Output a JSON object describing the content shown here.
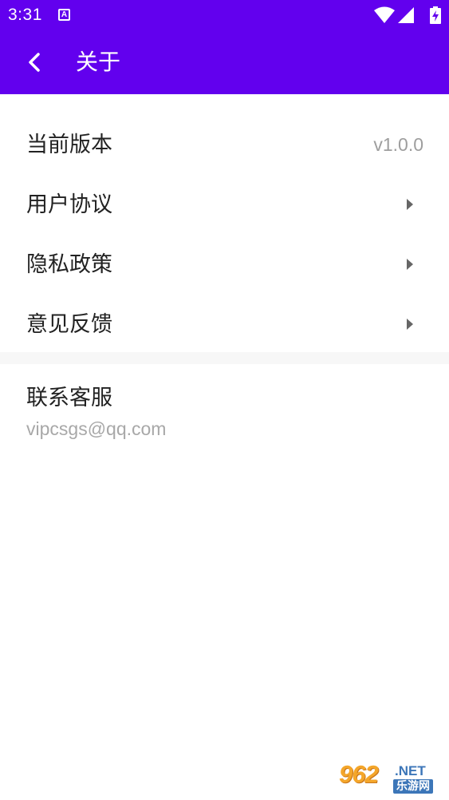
{
  "status_bar": {
    "time": "3:31",
    "notification_glyph": "A",
    "icons": [
      "wifi-icon",
      "cell-signal-icon",
      "battery-charging-icon"
    ]
  },
  "app_bar": {
    "title": "关于",
    "back_icon": "chevron-left-icon",
    "background_color": "#6200ee"
  },
  "items": [
    {
      "label": "当前版本",
      "value": "v1.0.0"
    },
    {
      "label": "用户协议",
      "icon": "triangle-right-icon"
    },
    {
      "label": "隐私政策",
      "icon": "triangle-right-icon"
    },
    {
      "label": "意见反馈",
      "icon": "triangle-right-icon"
    }
  ],
  "contact": {
    "label": "联系客服",
    "email": "vipcsgs@qq.com"
  },
  "watermark": {
    "number": "962",
    "suffix": ".NET",
    "text": "乐游网"
  }
}
